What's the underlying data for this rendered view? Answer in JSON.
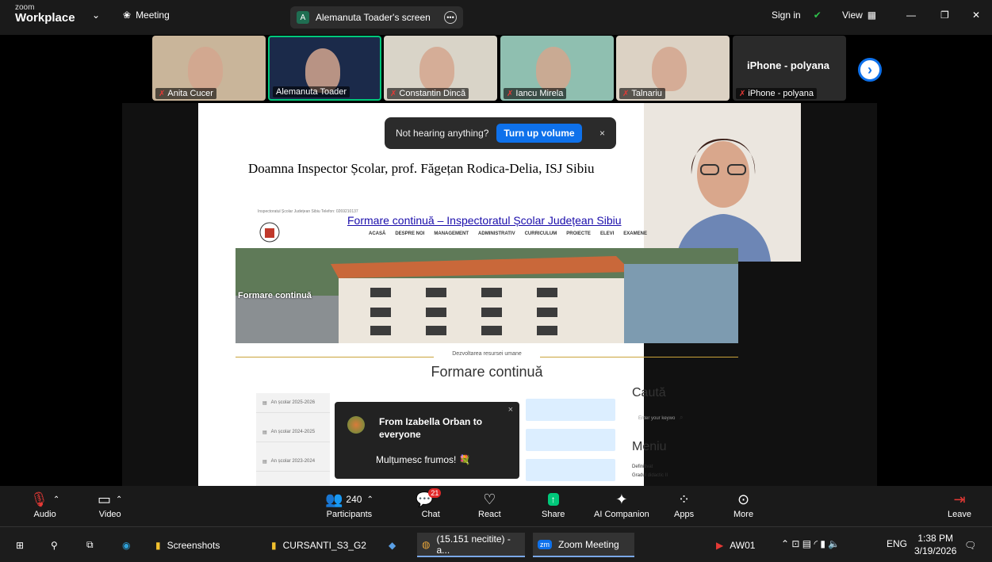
{
  "app": {
    "logo_small": "zoom",
    "logo_big": "Workplace",
    "meeting_label": "Meeting",
    "screen_label": "Alemanuta Toader's screen",
    "screen_avatar": "A",
    "sign_in": "Sign in",
    "view": "View"
  },
  "participants": [
    {
      "name": "Anita Cucer",
      "muted": true,
      "bg": "#c9b59a"
    },
    {
      "name": "Alemanuta Toader",
      "muted": false,
      "bg": "#1b2a4a"
    },
    {
      "name": "Constantin Dincă",
      "muted": true,
      "bg": "#d9d4c8"
    },
    {
      "name": "Iancu Mirela",
      "muted": true,
      "bg": "#8fbfb0"
    },
    {
      "name": "Talnariu",
      "muted": true,
      "bg": "#dcd2c4"
    },
    {
      "name": "iPhone - polyana",
      "muted": true,
      "bg": "#2a2a2a"
    }
  ],
  "iphone_tile_title": "iPhone - polyana",
  "banner": {
    "text": "Not hearing anything?",
    "button": "Turn up volume",
    "close": "×"
  },
  "slide": {
    "title": "Doamna Inspector Școlar, prof. Făgețan Rodica-Delia, ISJ Sibiu",
    "tiny_header": "Inspectoratul Școlar Județean Sibiu   Telefon: 0269210137",
    "link": "Formare continuă – Inspectoratul Școlar Județean Sibiu",
    "nav": [
      "ACASĂ",
      "DESPRE NOI",
      "MANAGEMENT",
      "ADMINISTRATIV",
      "CURRICULUM",
      "PROIECTE",
      "ELEVI",
      "EXAMENE"
    ],
    "photo_label": "Formare continuă",
    "subhead": "Dezvoltarea resursei umane",
    "main_title": "Formare continuă",
    "years": [
      "An școlar 2025-2026",
      "An școlar 2024-2025",
      "An școlar 2023-2024",
      "An școlar 2022-2023"
    ],
    "search_title": "Caută",
    "search_placeholder": "Enter your keywo",
    "menu_title": "Meniu",
    "menu_items": [
      "Definitivat",
      "Gradul didactic II"
    ]
  },
  "chat_toast": {
    "from": "From Izabella Orban to everyone",
    "message": "Mulțumesc frumos! 💐",
    "close": "×"
  },
  "toolbar": {
    "audio": "Audio",
    "video": "Video",
    "participants": "Participants",
    "participants_count": "240",
    "chat": "Chat",
    "chat_badge": "21",
    "react": "React",
    "share": "Share",
    "ai": "AI Companion",
    "apps": "Apps",
    "more": "More",
    "leave": "Leave"
  },
  "taskbar": {
    "screenshots": "Screenshots",
    "cursanti": "CURSANTI_S3_G2",
    "chrome": "(15.151 necitite) - a...",
    "zoom": "Zoom Meeting",
    "aw": "AW01",
    "lang": "ENG",
    "time": "1:38 PM",
    "date": "3/19/2026"
  },
  "colors": {
    "accent": "#0e71eb",
    "chat_badge": "#e02828",
    "active_border": "#00c87a"
  }
}
